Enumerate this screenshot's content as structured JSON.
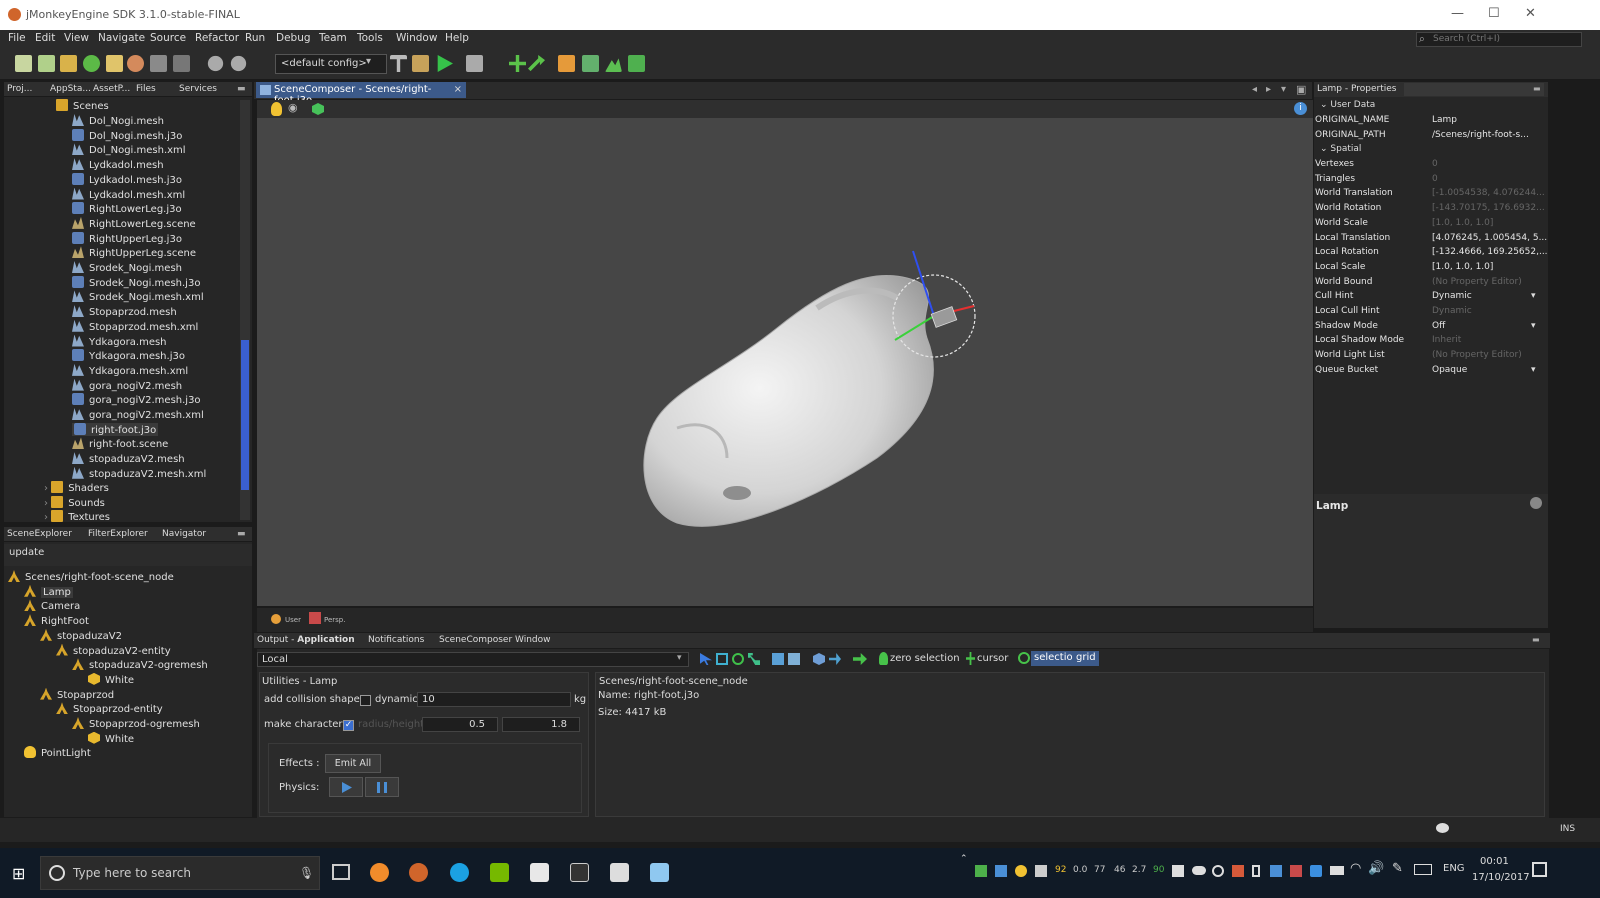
{
  "window": {
    "title": "jMonkeyEngine SDK 3.1.0-stable-FINAL",
    "min": "—",
    "max": "☐",
    "close": "✕"
  },
  "menu": [
    "File",
    "Edit",
    "View",
    "Navigate",
    "Source",
    "Refactor",
    "Run",
    "Debug",
    "Team",
    "Tools",
    "Window",
    "Help"
  ],
  "search_placeholder": "Search (Ctrl+I)",
  "toolbar": {
    "config": "<default config>"
  },
  "project_tabs": [
    "Proj...",
    "AppSta...",
    "AssetP...",
    "Files",
    "Services"
  ],
  "project_tree": {
    "root": "Scenes",
    "items": [
      {
        "label": "Dol_Nogi.mesh",
        "type": "mesh"
      },
      {
        "label": "Dol_Nogi.mesh.j3o",
        "type": "j3o"
      },
      {
        "label": "Dol_Nogi.mesh.xml",
        "type": "mesh"
      },
      {
        "label": "Lydkadol.mesh",
        "type": "mesh"
      },
      {
        "label": "Lydkadol.mesh.j3o",
        "type": "j3o"
      },
      {
        "label": "Lydkadol.mesh.xml",
        "type": "mesh"
      },
      {
        "label": "RightLowerLeg.j3o",
        "type": "j3o"
      },
      {
        "label": "RightLowerLeg.scene",
        "type": "scene"
      },
      {
        "label": "RightUpperLeg.j3o",
        "type": "j3o"
      },
      {
        "label": "RightUpperLeg.scene",
        "type": "scene"
      },
      {
        "label": "Srodek_Nogi.mesh",
        "type": "mesh"
      },
      {
        "label": "Srodek_Nogi.mesh.j3o",
        "type": "j3o"
      },
      {
        "label": "Srodek_Nogi.mesh.xml",
        "type": "mesh"
      },
      {
        "label": "Stopaprzod.mesh",
        "type": "mesh"
      },
      {
        "label": "Stopaprzod.mesh.xml",
        "type": "mesh"
      },
      {
        "label": "Ydkagora.mesh",
        "type": "mesh"
      },
      {
        "label": "Ydkagora.mesh.j3o",
        "type": "j3o"
      },
      {
        "label": "Ydkagora.mesh.xml",
        "type": "mesh"
      },
      {
        "label": "gora_nogiV2.mesh",
        "type": "mesh"
      },
      {
        "label": "gora_nogiV2.mesh.j3o",
        "type": "j3o"
      },
      {
        "label": "gora_nogiV2.mesh.xml",
        "type": "mesh"
      },
      {
        "label": "right-foot.j3o",
        "type": "j3o",
        "selected": true
      },
      {
        "label": "right-foot.scene",
        "type": "scene"
      },
      {
        "label": "stopaduzaV2.mesh",
        "type": "mesh"
      },
      {
        "label": "stopaduzaV2.mesh.xml",
        "type": "mesh"
      }
    ],
    "folders": [
      "Shaders",
      "Sounds",
      "Textures"
    ]
  },
  "explorer_tabs": [
    "SceneExplorer",
    "FilterExplorer",
    "Navigator"
  ],
  "explorer_update": "update",
  "scene_tree": [
    {
      "label": "Scenes/right-foot-scene_node",
      "depth": 0,
      "icon": "node"
    },
    {
      "label": "Lamp",
      "depth": 1,
      "icon": "node",
      "selected": true
    },
    {
      "label": "Camera",
      "depth": 1,
      "icon": "node"
    },
    {
      "label": "RightFoot",
      "depth": 1,
      "icon": "node"
    },
    {
      "label": "stopaduzaV2",
      "depth": 2,
      "icon": "node"
    },
    {
      "label": "stopaduzaV2-entity",
      "depth": 3,
      "icon": "node"
    },
    {
      "label": "stopaduzaV2-ogremesh",
      "depth": 4,
      "icon": "node"
    },
    {
      "label": "White",
      "depth": 5,
      "icon": "geo"
    },
    {
      "label": "Stopaprzod",
      "depth": 2,
      "icon": "node"
    },
    {
      "label": "Stopaprzod-entity",
      "depth": 3,
      "icon": "node"
    },
    {
      "label": "Stopaprzod-ogremesh",
      "depth": 4,
      "icon": "node"
    },
    {
      "label": "White",
      "depth": 5,
      "icon": "geo"
    },
    {
      "label": "PointLight",
      "depth": 1,
      "icon": "light"
    }
  ],
  "editor_tab": "SceneComposer - Scenes/right-foot.j3o",
  "viewport_bottom": {
    "user": "User",
    "persp": "Persp."
  },
  "properties": {
    "title": "Lamp - Properties",
    "section_user": "User Data",
    "section_spatial": "Spatial",
    "rows_user": [
      {
        "k": "ORIGINAL_NAME",
        "v": "Lamp"
      },
      {
        "k": "ORIGINAL_PATH",
        "v": "/Scenes/right-foot-s..."
      }
    ],
    "rows_spatial": [
      {
        "k": "Vertexes",
        "v": "0",
        "dim": true
      },
      {
        "k": "Triangles",
        "v": "0",
        "dim": true
      },
      {
        "k": "World Translation",
        "v": "[-1.0054538, 4.076244...",
        "dim": true
      },
      {
        "k": "World Rotation",
        "v": "[-143.70175, 176.6932...",
        "dim": true
      },
      {
        "k": "World Scale",
        "v": "[1.0, 1.0, 1.0]",
        "dim": true
      },
      {
        "k": "Local Translation",
        "v": "[4.076245, 1.005454, 5..."
      },
      {
        "k": "Local Rotation",
        "v": "[-132.4666, 169.25652,..."
      },
      {
        "k": "Local Scale",
        "v": "[1.0, 1.0, 1.0]"
      },
      {
        "k": "World Bound",
        "v": "(No Property Editor)",
        "dim": true
      },
      {
        "k": "Cull Hint",
        "v": "Dynamic",
        "dropdown": true
      },
      {
        "k": "Local Cull Hint",
        "v": "Dynamic",
        "dim": true
      },
      {
        "k": "Shadow Mode",
        "v": "Off",
        "dropdown": true
      },
      {
        "k": "Local Shadow Mode",
        "v": "Inherit",
        "dim": true
      },
      {
        "k": "World Light List",
        "v": "(No Property Editor)",
        "dim": true
      },
      {
        "k": "Queue Bucket",
        "v": "Opaque",
        "dropdown": true
      }
    ],
    "footer": "Lamp"
  },
  "output": {
    "tabs": [
      "Output - ",
      "Application",
      "Notifications",
      "SceneComposer Window"
    ],
    "local": "Local",
    "zero_selection": "zero selection",
    "cursor": "cursor",
    "selection": "selection",
    "grid": "grid",
    "utilities_title": "Utilities - Lamp",
    "collision_label": "add collision shape",
    "dynamic_label": "dynamic:",
    "dynamic_value": "10",
    "kg": "kg",
    "character_label": "make character",
    "radius_label": "radius/height",
    "radius_value": "0.5",
    "height_value": "1.8",
    "effects_label": "Effects :",
    "emit_all": "Emit All",
    "physics_label": "Physics:",
    "info_lines": [
      "Scenes/right-foot-scene_node",
      "Name: right-foot.j3o",
      "Size: 4417 kB"
    ]
  },
  "status": {
    "ins": "INS"
  },
  "taskbar": {
    "search": "Type here to search",
    "tray": [
      "92",
      "0.0",
      "77",
      "46",
      "2.7",
      "90"
    ],
    "lang": "ENG",
    "time": "00:01",
    "date": "17/10/2017"
  },
  "colors": {
    "selection": "#3c5a8a",
    "accent": "#2e7de1",
    "panel": "#262626"
  }
}
